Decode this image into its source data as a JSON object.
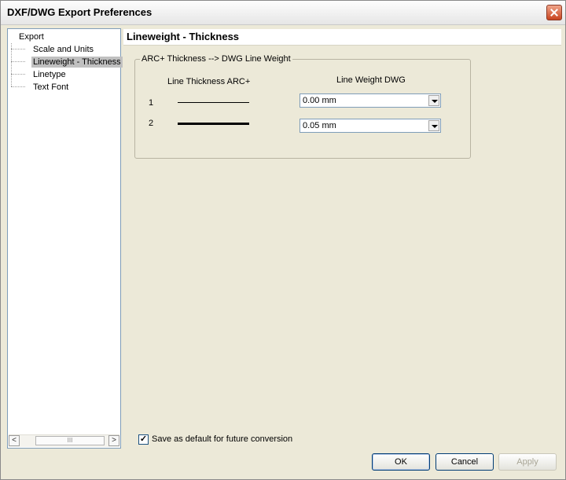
{
  "window": {
    "title": "DXF/DWG Export Preferences"
  },
  "tree": {
    "root": "Export",
    "items": [
      {
        "label": "Scale and Units",
        "selected": false
      },
      {
        "label": "Lineweight - Thickness",
        "selected": true
      },
      {
        "label": "Linetype",
        "selected": false
      },
      {
        "label": "Text Font",
        "selected": false
      }
    ],
    "scroll_left_glyph": "<",
    "scroll_right_glyph": ">",
    "scroll_thumb_glyph": "III"
  },
  "panel": {
    "title": "Lineweight - Thickness",
    "group_label": "ARC+ Thickness --> DWG Line Weight",
    "col_thickness": "Line Thickness ARC+",
    "col_weight": "Line Weight DWG",
    "rows": [
      {
        "num": "1",
        "weight": "0.00 mm"
      },
      {
        "num": "2",
        "weight": "0.05 mm"
      }
    ]
  },
  "save_default": {
    "checked": true,
    "label": "Save as default for future conversion",
    "check_glyph": "✓"
  },
  "buttons": {
    "ok": "OK",
    "cancel": "Cancel",
    "apply": "Apply"
  }
}
